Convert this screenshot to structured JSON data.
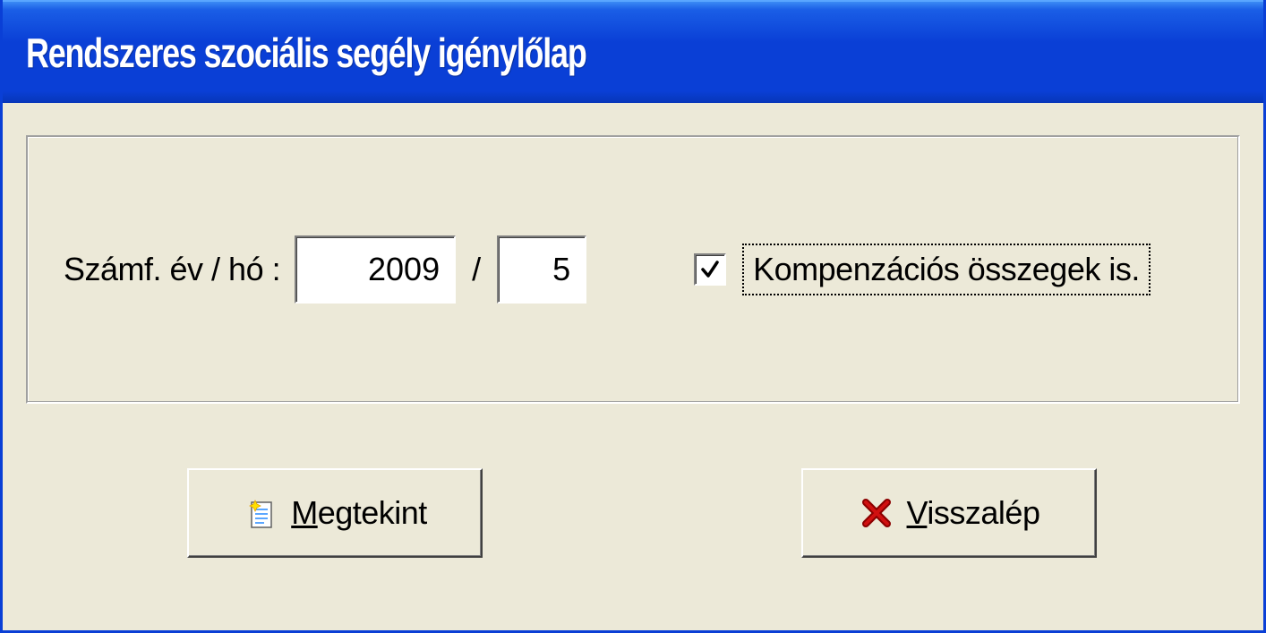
{
  "window": {
    "title": "Rendszeres szociális segély  igénylőlap"
  },
  "form": {
    "date_label": "Számf. év / hó :",
    "year": "2009",
    "slash": "/",
    "month": "5",
    "compensation_checked": true,
    "compensation_label": "Kompenzációs összegek is."
  },
  "buttons": {
    "view": "Megtekint",
    "back": "Visszalép"
  },
  "icons": {
    "document": "document-sparkle-icon",
    "close": "close-x-icon",
    "check": "checkmark-icon"
  },
  "colors": {
    "titlebar_blue": "#0a3fd6",
    "face": "#ece9d8",
    "close_red": "#a00000"
  }
}
